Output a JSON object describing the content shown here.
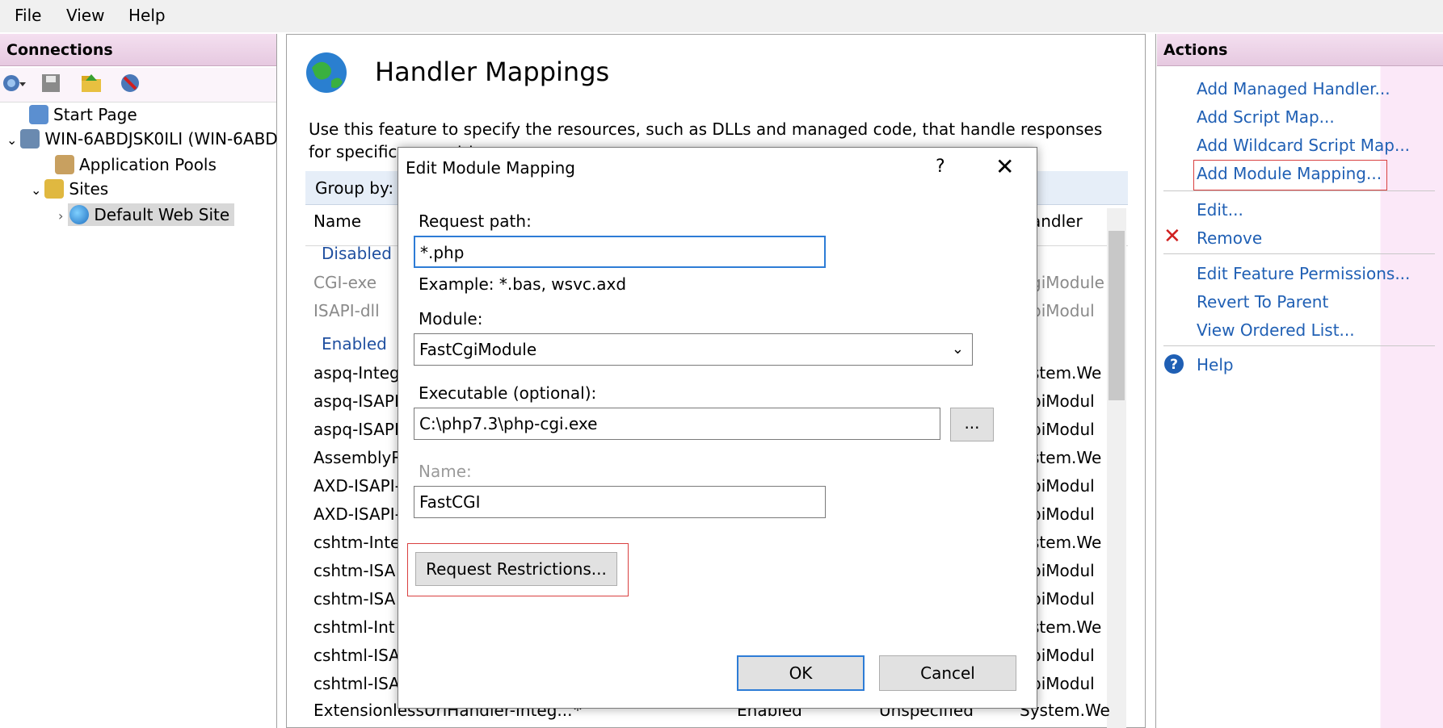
{
  "menu": {
    "file": "File",
    "view": "View",
    "help": "Help"
  },
  "connections": {
    "header": "Connections",
    "tree": {
      "start_page": "Start Page",
      "server": "WIN-6ABDJSK0ILI (WIN-6ABD",
      "app_pools": "Application Pools",
      "sites": "Sites",
      "default_site": "Default Web Site"
    }
  },
  "main": {
    "title": "Handler Mappings",
    "description": "Use this feature to specify the resources, such as DLLs and managed code, that handle responses for specific request type",
    "group_by": "Group by:",
    "columns": {
      "name": "Name",
      "handler": "andler"
    },
    "groups": {
      "disabled": "Disabled",
      "enabled": "Enabled"
    },
    "disabled_rows": [
      {
        "name": "CGI-exe",
        "handler": "giModule"
      },
      {
        "name": "ISAPI-dll",
        "handler": "piModul"
      }
    ],
    "enabled_rows": [
      {
        "name": "aspq-Integ",
        "handler": "stem.We"
      },
      {
        "name": "aspq-ISAPI",
        "handler": "piModul"
      },
      {
        "name": "aspq-ISAPI",
        "handler": "piModul"
      },
      {
        "name": "AssemblyR",
        "handler": "stem.We"
      },
      {
        "name": "AXD-ISAPI-",
        "handler": "piModul"
      },
      {
        "name": "AXD-ISAPI-",
        "handler": "piModul"
      },
      {
        "name": "cshtm-Inte",
        "handler": "stem.We"
      },
      {
        "name": "cshtm-ISA",
        "handler": "piModul"
      },
      {
        "name": "cshtm-ISA",
        "handler": "piModul"
      },
      {
        "name": "cshtml-Int",
        "handler": "stem.We"
      },
      {
        "name": "cshtml-ISA",
        "handler": "piModul"
      },
      {
        "name": "cshtml-ISA",
        "handler": "piModul"
      }
    ],
    "last_row": {
      "name": "ExtensionlessUrlHandler-Integ...",
      "path": "*",
      "state": "Enabled",
      "type": "Unspecified",
      "handler": "System.We"
    }
  },
  "actions": {
    "header": "Actions",
    "add_managed": "Add Managed Handler...",
    "add_script": "Add Script Map...",
    "add_wildcard": "Add Wildcard Script Map...",
    "add_module": "Add Module Mapping...",
    "edit": "Edit...",
    "remove": "Remove",
    "edit_perms": "Edit Feature Permissions...",
    "revert": "Revert To Parent",
    "view_ordered": "View Ordered List...",
    "help": "Help"
  },
  "dialog": {
    "title": "Edit Module Mapping",
    "help_glyph": "?",
    "close_glyph": "✕",
    "request_path_label": "Request path:",
    "request_path_value": "*.php",
    "example": "Example: *.bas, wsvc.axd",
    "module_label": "Module:",
    "module_value": "FastCgiModule",
    "executable_label": "Executable (optional):",
    "executable_value": "C:\\php7.3\\php-cgi.exe",
    "browse": "...",
    "name_label": "Name:",
    "name_value": "FastCGI",
    "request_restrictions": "Request Restrictions...",
    "ok": "OK",
    "cancel": "Cancel"
  },
  "colors": {
    "link": "#1f5fb4",
    "highlight": "#d94040",
    "focus": "#2d7cd6"
  }
}
